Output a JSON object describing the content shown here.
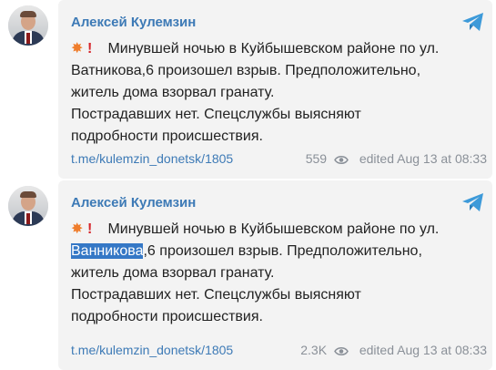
{
  "posts": [
    {
      "author": "Алексей Кулемзин",
      "icon": "telegram-icon",
      "lines": [
        "Минувшей ночью в Куйбышевском районе по ул.",
        "Ватникова,6 произошел взрыв. Предположительно,",
        "житель дома взорвал гранату.",
        "Пострадавших нет. Спецслужбы выясняют",
        "подробности происшествия."
      ],
      "link": "t.me/kulemzin_donetsk/1805",
      "views": "559",
      "edited": "edited",
      "date": "Aug 13 at 08:33"
    },
    {
      "author": "Алексей Кулемзин",
      "icon": "telegram-icon",
      "line1": "Минувшей ночью в Куйбышевском районе по ул.",
      "highlight": "Ванникова",
      "line2_rest": ",6 произошел взрыв. Предположительно,",
      "line3": "житель дома взорвал гранату.",
      "line4": "Пострадавших нет. Спецслужбы выясняют",
      "line5": "подробности происшествия.",
      "link": "t.me/kulemzin_donetsk/1805",
      "views": "2.3K",
      "edited": "edited",
      "date": "Aug 13 at 08:33"
    }
  ],
  "colors": {
    "author": "#3d7ab6",
    "highlight_bg": "#3578c6",
    "bubble": "#f3f3f3"
  }
}
